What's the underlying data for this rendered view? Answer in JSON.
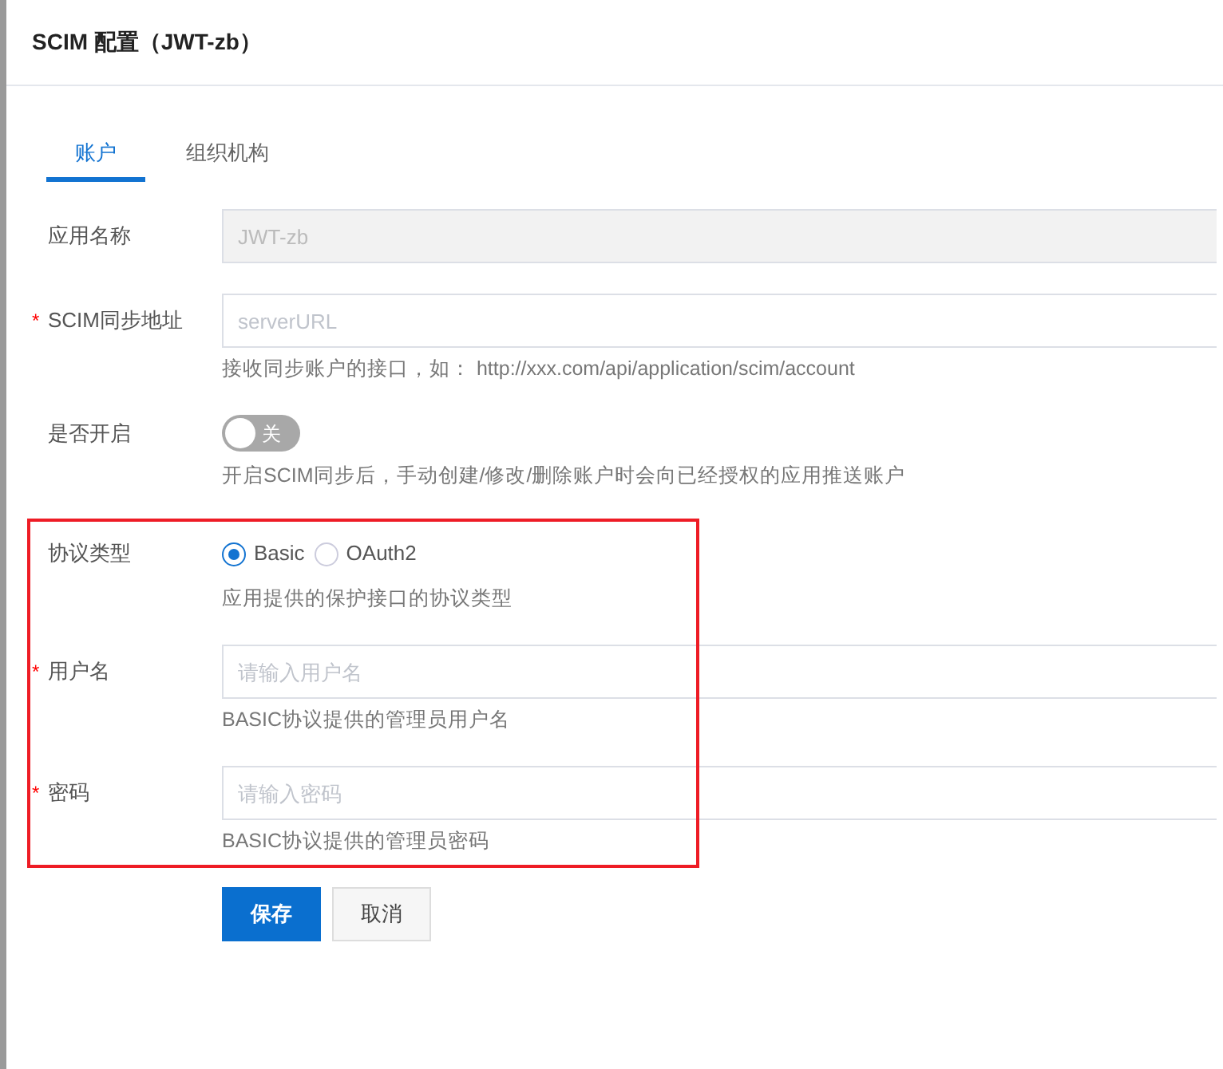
{
  "dialog": {
    "title": "SCIM 配置（JWT-zb）"
  },
  "tabs": [
    {
      "label": "账户",
      "selected": true
    },
    {
      "label": "组织机构",
      "selected": false
    }
  ],
  "form": {
    "sections": [
      {
        "highlighted": false,
        "items": [
          {
            "kind": "input",
            "label": "应用名称",
            "disabled": true,
            "value": "JWT-zb"
          },
          {
            "kind": "input",
            "label": "SCIM同步地址",
            "required_mark": "*",
            "disabled": false,
            "placeholder": "serverURL",
            "help": "接收同步账户的接口，如： http://xxx.com/api/application/scim/account"
          },
          {
            "kind": "toggle",
            "label": "是否开启",
            "on": false,
            "toggle_text": "关",
            "help": "开启SCIM同步后，手动创建/修改/删除账户时会向已经授权的应用推送账户"
          }
        ]
      },
      {
        "highlighted": true,
        "items": [
          {
            "kind": "radio",
            "label": "协议类型",
            "options": [
              {
                "label": "Basic",
                "selected": true
              },
              {
                "label": "OAuth2",
                "selected": false
              }
            ],
            "help": "应用提供的保护接口的协议类型"
          },
          {
            "kind": "input",
            "label": "用户名",
            "required_mark": "*",
            "disabled": false,
            "placeholder": "请输入用户名",
            "help": "BASIC协议提供的管理员用户名"
          },
          {
            "kind": "input",
            "label": "密码",
            "required_mark": "*",
            "disabled": false,
            "placeholder": "请输入密码",
            "help": "BASIC协议提供的管理员密码"
          }
        ]
      }
    ]
  },
  "buttons": [
    {
      "label": "保存",
      "kind": "primary"
    },
    {
      "label": "取消",
      "kind": "default"
    }
  ]
}
